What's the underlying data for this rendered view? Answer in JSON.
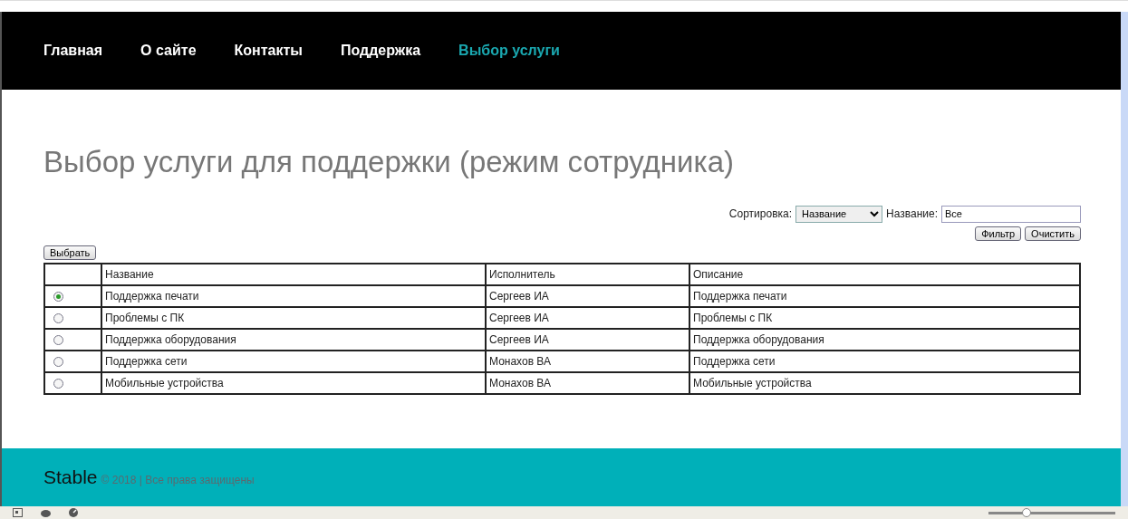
{
  "nav": {
    "items": [
      {
        "label": "Главная",
        "selected": false
      },
      {
        "label": "О сайте",
        "selected": false
      },
      {
        "label": "Контакты",
        "selected": false
      },
      {
        "label": "Поддержка",
        "selected": false
      },
      {
        "label": "Выбор услуги",
        "selected": true
      }
    ]
  },
  "title": "Выбор услуги для поддержки (режим сотрудника)",
  "filter": {
    "sort_label": "Сортировка:",
    "sort_value": "Название",
    "name_label": "Название:",
    "name_value": "Все",
    "buttons": [
      "Фильтр",
      "Очистить"
    ]
  },
  "select_button": "Выбрать",
  "table": {
    "columns": [
      "Название",
      "Исполнитель",
      "Описание"
    ],
    "rows": [
      {
        "selected": true,
        "cells": [
          "Поддержка печати",
          "Сергеев ИА",
          "Поддержка печати"
        ]
      },
      {
        "selected": false,
        "cells": [
          "Проблемы с ПК",
          "Сергеев ИА",
          "Проблемы с ПК"
        ]
      },
      {
        "selected": false,
        "cells": [
          "Поддержка оборудования",
          "Сергеев ИА",
          "Поддержка оборудования"
        ]
      },
      {
        "selected": false,
        "cells": [
          "Поддержка сети",
          "Монахов ВА",
          "Поддержка сети"
        ]
      },
      {
        "selected": false,
        "cells": [
          "Мобильные устройства",
          "Монахов ВА",
          "Мобильные устройства"
        ]
      }
    ]
  },
  "footer": {
    "brand": "Stable",
    "copyright": "© 2018 | Все права защищены"
  },
  "status_bar": {
    "zoom_slider": {
      "level": 0.3
    }
  }
}
